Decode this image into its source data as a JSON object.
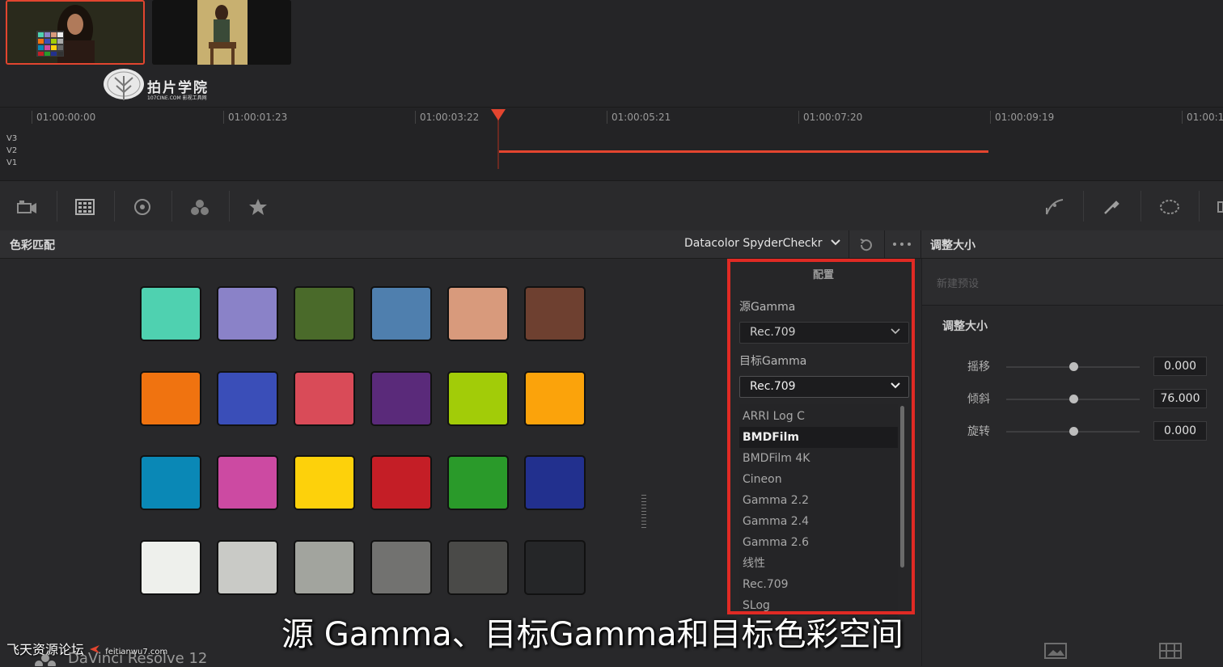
{
  "watermark": {
    "logo_text": "拍片学院",
    "logo_sub": "107CINE.COM 影视工具网"
  },
  "timeline": {
    "timecodes": [
      "01:00:00:00",
      "01:00:01:23",
      "01:00:03:22",
      "01:00:05:21",
      "01:00:07:20",
      "01:00:09:19",
      "01:00:1"
    ],
    "tracks": [
      "V3",
      "V2",
      "V1"
    ]
  },
  "header": {
    "panel_title": "色彩匹配",
    "chart_selected": "Datacolor SpyderCheckr",
    "right_title": "调整大小"
  },
  "swatches": [
    "#4fd1b0",
    "#8a82c8",
    "#4a6a2a",
    "#4f7fae",
    "#d89a7c",
    "#6e4030",
    "#f07310",
    "#3a4eb8",
    "#d94b58",
    "#5a2a7a",
    "#a2cc08",
    "#fba30b",
    "#0a88b6",
    "#cc4aa2",
    "#fdd10b",
    "#c41e26",
    "#2a9a2a",
    "#22308e",
    "#eef0ec",
    "#c9cac6",
    "#a2a49e",
    "#727270",
    "#4a4a48",
    "#252628"
  ],
  "config": {
    "title": "配置",
    "source_gamma_label": "源Gamma",
    "source_gamma_value": "Rec.709",
    "target_gamma_label": "目标Gamma",
    "target_gamma_value": "Rec.709",
    "options": [
      "ARRI Log C",
      "BMDFilm",
      "BMDFilm 4K",
      "Cineon",
      "Gamma 2.2",
      "Gamma 2.4",
      "Gamma 2.6",
      "线性",
      "Rec.709",
      "SLog"
    ],
    "highlighted_option": "BMDFilm"
  },
  "right_panel": {
    "preset_placeholder": "新建预设",
    "section_title": "调整大小",
    "sliders": [
      {
        "label": "摇移",
        "value": "0.000",
        "level": 0.5
      },
      {
        "label": "倾斜",
        "value": "76.000",
        "level": 0.5
      },
      {
        "label": "旋转",
        "value": "0.000",
        "level": 0.5
      }
    ]
  },
  "subtitle": "源 Gamma、目标Gamma和目标色彩空间",
  "site_watermark": {
    "name": "飞天资源论坛",
    "url": "feitianwu7.com"
  },
  "app_name": "DaVinci Resolve 12",
  "colors": {
    "accent": "#e4452f",
    "highlight_box": "#e02a24"
  }
}
